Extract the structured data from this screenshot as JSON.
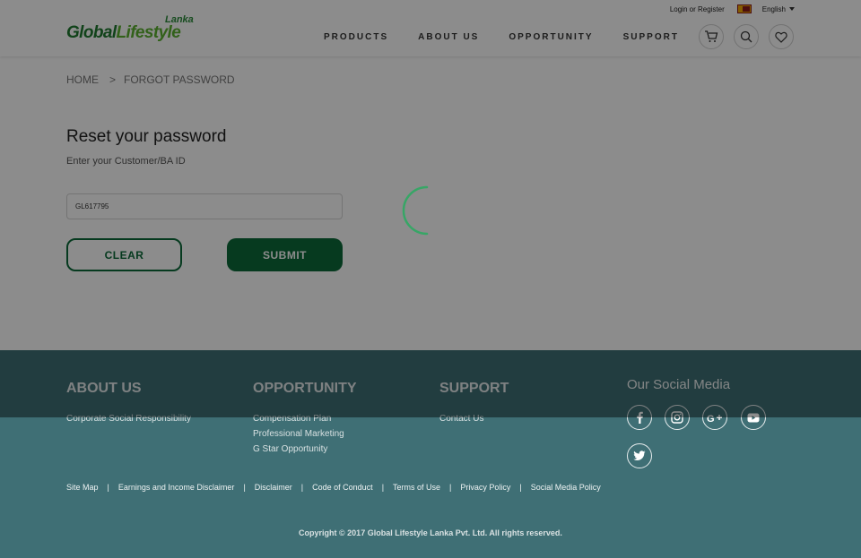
{
  "header": {
    "logo_top": "Lanka",
    "logo_main_a": "Global",
    "logo_main_b": "Lifestyle",
    "login_text": "Login or Register",
    "language": "English",
    "nav": [
      "PRODUCTS",
      "ABOUT US",
      "OPPORTUNITY",
      "SUPPORT"
    ],
    "icons": [
      "cart-icon",
      "search-icon",
      "heart-icon"
    ]
  },
  "breadcrumb": {
    "home": "HOME",
    "separator": ">",
    "current": "FORGOT PASSWORD"
  },
  "form": {
    "title": "Reset your password",
    "subtitle": "Enter your Customer/BA ID",
    "id_value": "GL617795",
    "clear_label": "CLEAR",
    "submit_label": "SUBMIT"
  },
  "footer": {
    "about_title": "ABOUT US",
    "about_links": [
      "Corporate Social Responsibility"
    ],
    "opportunity_title": "OPPORTUNITY",
    "opportunity_links": [
      "Compensation Plan",
      "Professional Marketing",
      "G Star Opportunity"
    ],
    "support_title": "SUPPORT",
    "support_links": [
      "Contact Us"
    ],
    "social_title": "Our Social Media",
    "social_icons": [
      "facebook-icon",
      "instagram-icon",
      "google-plus-icon",
      "youtube-icon",
      "twitter-icon"
    ],
    "bottom_links": [
      "Site Map",
      "Earnings and Income Disclaimer",
      "Disclaimer",
      "Code of Conduct",
      "Terms of Use",
      "Privacy Policy",
      "Social Media Policy"
    ],
    "bottom_separator": "|",
    "copyright": "Copyright © 2017 Global Lifestyle Lanka Pvt. Ltd. All rights reserved."
  },
  "colors": {
    "brand_green": "#0b6b3a",
    "logo_green": "#1f7a30",
    "footer_bg": "#3f6f75",
    "spinner": "#2ea862"
  }
}
